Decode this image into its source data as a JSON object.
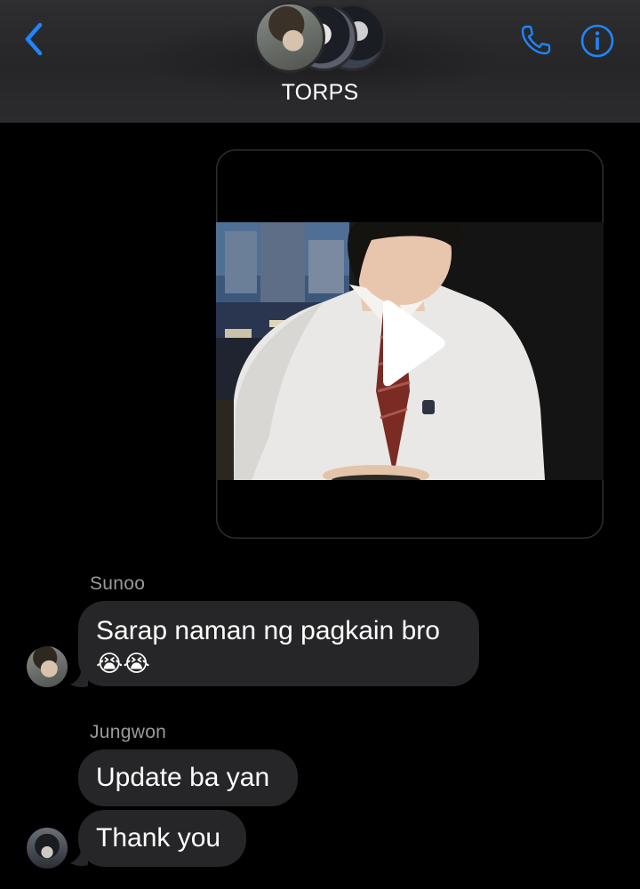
{
  "header": {
    "group_name": "TORPS",
    "back_icon": "chevron-left-icon",
    "call_icon": "phone-icon",
    "info_icon": "info-icon",
    "accent_color": "#1e86ff"
  },
  "thread": {
    "video_message": {
      "type": "video",
      "play_icon": "play-icon"
    },
    "messages": [
      {
        "sender": "Sunoo",
        "text": "Sarap naman ng pagkain bro",
        "emoji": "😭😭"
      },
      {
        "sender": "Jungwon",
        "text": "Update ba yan"
      },
      {
        "sender": "",
        "text": "Thank you"
      }
    ]
  }
}
